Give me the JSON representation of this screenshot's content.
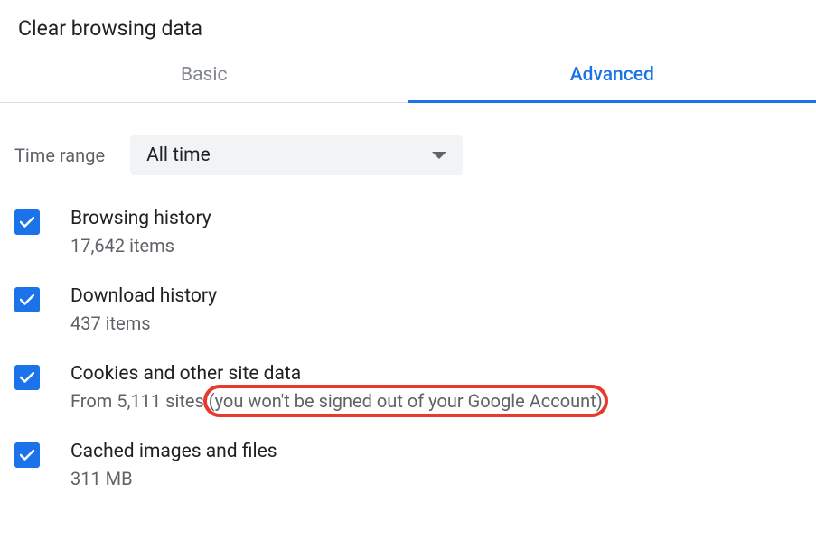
{
  "title": "Clear browsing data",
  "tabs": {
    "basic": "Basic",
    "advanced": "Advanced"
  },
  "timeRange": {
    "label": "Time range",
    "value": "All time"
  },
  "options": [
    {
      "title": "Browsing history",
      "sub": "17,642 items"
    },
    {
      "title": "Download history",
      "sub": "437 items"
    },
    {
      "title": "Cookies and other site data",
      "subPrefix": "From 5,111 sites ",
      "subHighlight": "(you won't be signed out of your Google Account)"
    },
    {
      "title": "Cached images and files",
      "sub": "311 MB"
    }
  ],
  "colors": {
    "accent": "#1a73e8",
    "highlight": "#e8392d"
  }
}
